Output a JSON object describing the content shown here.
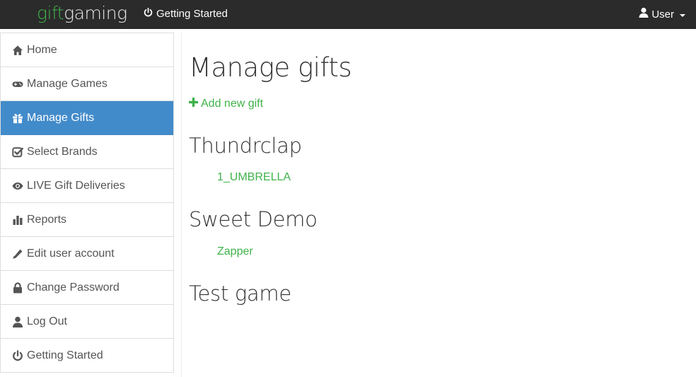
{
  "navbar": {
    "brand_gift": "gift",
    "brand_gaming": "gaming",
    "getting_started": "Getting Started",
    "user": "User"
  },
  "sidebar": {
    "items": [
      {
        "label": "Home",
        "icon": "home-icon"
      },
      {
        "label": "Manage Games",
        "icon": "gamepad-icon"
      },
      {
        "label": "Manage Gifts",
        "icon": "gift-icon",
        "active": true
      },
      {
        "label": "Select Brands",
        "icon": "check-square-icon"
      },
      {
        "label": "LIVE Gift Deliveries",
        "icon": "eye-icon"
      },
      {
        "label": "Reports",
        "icon": "bar-chart-icon"
      },
      {
        "label": "Edit user account",
        "icon": "pencil-icon"
      },
      {
        "label": "Change Password",
        "icon": "lock-icon"
      },
      {
        "label": "Log Out",
        "icon": "user-icon"
      },
      {
        "label": "Getting Started",
        "icon": "power-icon"
      }
    ]
  },
  "main": {
    "title": "Manage gifts",
    "add_new": "Add new gift",
    "games": [
      {
        "name": "Thundrclap",
        "gifts": [
          "1_UMBRELLA"
        ]
      },
      {
        "name": "Sweet Demo",
        "gifts": [
          "Zapper"
        ]
      },
      {
        "name": "Test game",
        "gifts": []
      }
    ]
  },
  "colors": {
    "navbar_bg": "#2b2b2b",
    "brand_green": "#3fb24a",
    "active_blue": "#428bca",
    "link_green": "#3fb24a"
  }
}
